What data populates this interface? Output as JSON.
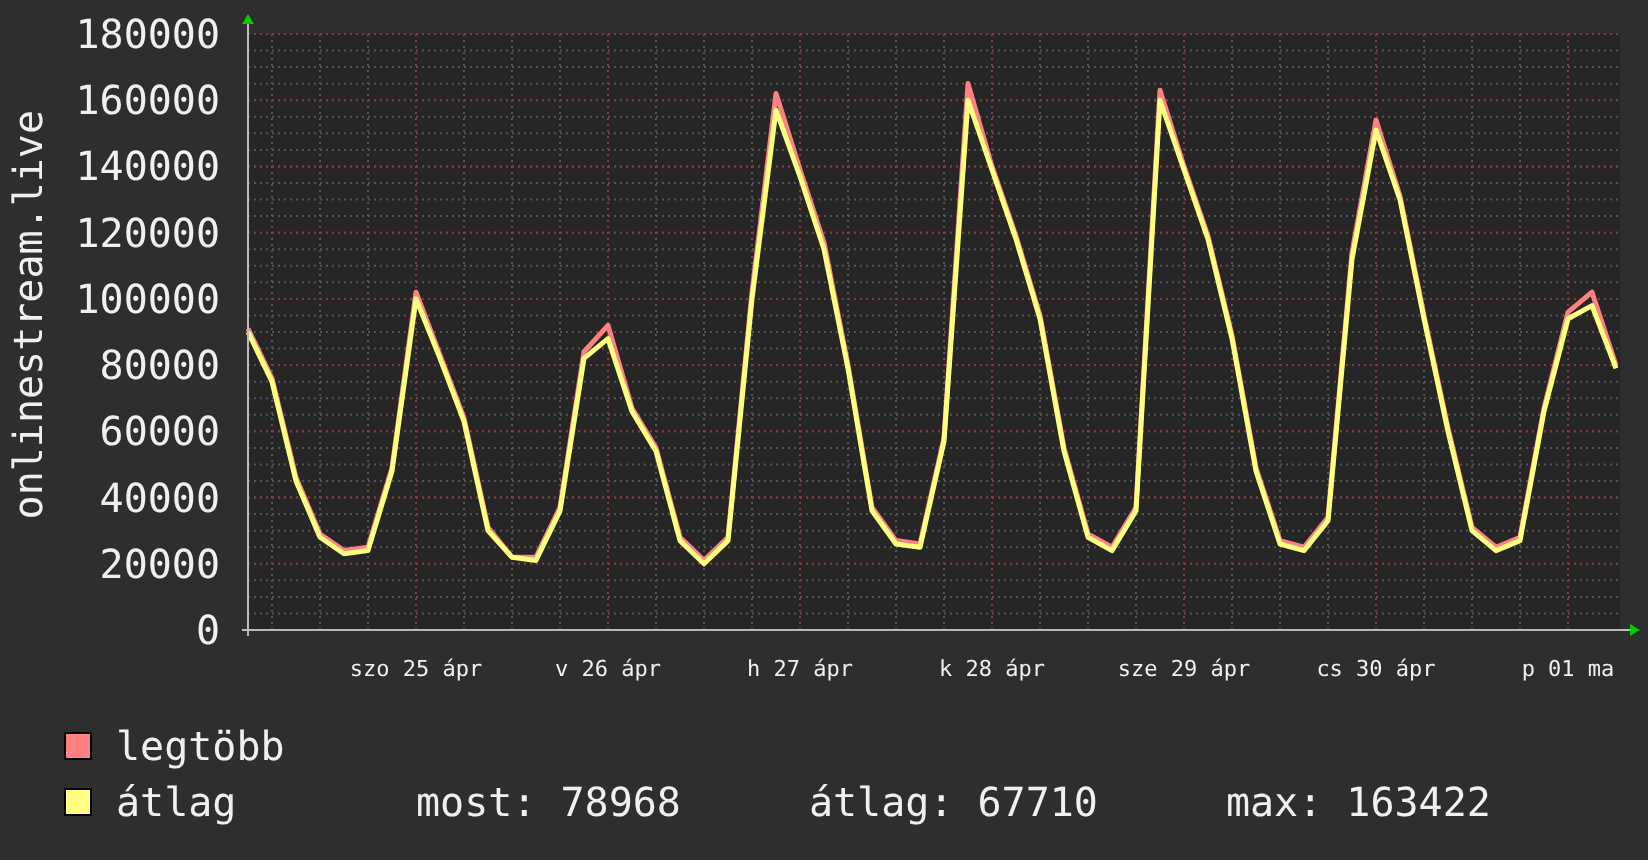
{
  "chart": {
    "chart_data": {
      "type": "line",
      "ylabel": "onlinestream.live",
      "categories": [
        null,
        null,
        null,
        null,
        null,
        null,
        null,
        "szo 25 ápr",
        null,
        null,
        null,
        null,
        null,
        null,
        null,
        "v 26 ápr",
        null,
        null,
        null,
        null,
        null,
        null,
        null,
        "h 27 ápr",
        null,
        null,
        null,
        null,
        null,
        null,
        null,
        "k 28 ápr",
        null,
        null,
        null,
        null,
        null,
        null,
        null,
        "sze 29 ápr",
        null,
        null,
        null,
        null,
        null,
        null,
        null,
        "cs 30 ápr",
        null,
        null,
        null,
        null,
        null,
        null,
        null,
        "p 01 ma",
        null,
        null
      ],
      "series": [
        {
          "name": "legtöbb",
          "color": "#ff8080",
          "values": [
            91000,
            76000,
            46000,
            29000,
            24000,
            25000,
            49000,
            102000,
            83000,
            64000,
            31000,
            22000,
            22000,
            37000,
            84000,
            92000,
            67000,
            55000,
            28000,
            21000,
            28000,
            102000,
            162000,
            139000,
            117000,
            80000,
            37000,
            27000,
            26000,
            58000,
            165000,
            140000,
            119000,
            95000,
            55000,
            29000,
            25000,
            37000,
            163000,
            140000,
            119000,
            89000,
            49000,
            27000,
            25000,
            34000,
            114000,
            154000,
            131000,
            95000,
            61000,
            31000,
            25000,
            28000,
            67000,
            96000,
            102000,
            80000
          ]
        },
        {
          "name": "átlag",
          "color": "#ffff80",
          "values": [
            90000,
            75000,
            45000,
            28000,
            23000,
            24000,
            48000,
            100000,
            82000,
            63000,
            30000,
            22000,
            21000,
            36000,
            82000,
            88000,
            66000,
            54000,
            27000,
            20000,
            27000,
            100000,
            157000,
            137000,
            115000,
            79000,
            36000,
            26000,
            25000,
            57000,
            160000,
            139000,
            118000,
            94000,
            54000,
            28000,
            24000,
            36000,
            160000,
            139000,
            118000,
            88000,
            48000,
            26000,
            24000,
            33000,
            112000,
            151000,
            130000,
            94000,
            60000,
            30000,
            24000,
            27000,
            66000,
            94000,
            98000,
            79000
          ]
        }
      ],
      "ylim": [
        0,
        180000
      ],
      "grid": true,
      "yticks": [
        0,
        20000,
        40000,
        60000,
        80000,
        100000,
        120000,
        140000,
        160000,
        180000
      ]
    }
  },
  "stats": [
    "most: 78968",
    "átlag: 67710",
    "max: 163422"
  ]
}
